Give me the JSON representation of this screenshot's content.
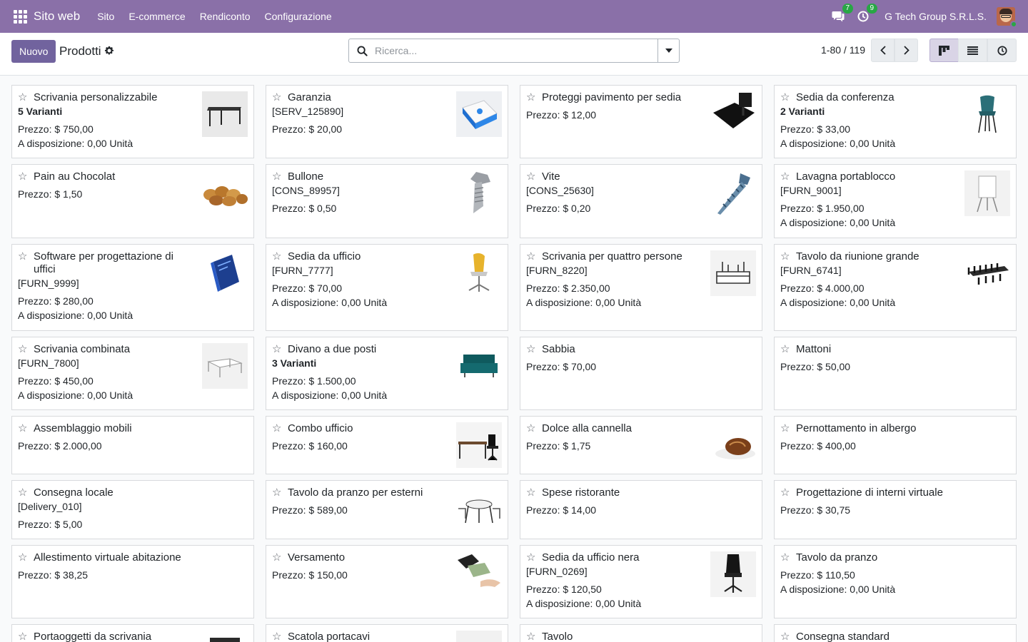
{
  "navbar": {
    "app_name": "Sito web",
    "menu": [
      "Sito",
      "E-commerce",
      "Rendiconto",
      "Configurazione"
    ],
    "messages_count": "7",
    "activities_count": "9",
    "company": "G Tech Group S.R.L.S."
  },
  "control_panel": {
    "new_label": "Nuovo",
    "title": "Prodotti",
    "search_placeholder": "Ricerca...",
    "pager": "1-80 / 119"
  },
  "products": [
    {
      "name": "Scrivania personalizzabile",
      "variants": "5 Varianti",
      "price": "Prezzo: $ 750,00",
      "stock": "A disposizione: 0,00 Unità",
      "image": "desk"
    },
    {
      "name": "Garanzia",
      "ref": "[SERV_125890]",
      "price": "Prezzo: $ 20,00",
      "image": "box"
    },
    {
      "name": "Proteggi pavimento per sedia",
      "price": "Prezzo: $ 12,00",
      "image": "mat"
    },
    {
      "name": "Sedia da conferenza",
      "variants": "2 Varianti",
      "price": "Prezzo: $ 33,00",
      "stock": "A disposizione: 0,00 Unità",
      "image": "chair-teal"
    },
    {
      "name": "Pain au Chocolat",
      "price": "Prezzo: $ 1,50",
      "image": "pastries"
    },
    {
      "name": "Bullone",
      "ref": "[CONS_89957]",
      "price": "Prezzo: $ 0,50",
      "image": "bolt"
    },
    {
      "name": "Vite",
      "ref": "[CONS_25630]",
      "price": "Prezzo: $ 0,20",
      "image": "screw"
    },
    {
      "name": "Lavagna portablocco",
      "ref": "[FURN_9001]",
      "price": "Prezzo: $ 1.950,00",
      "stock": "A disposizione: 0,00 Unità",
      "image": "flipchart"
    },
    {
      "name": "Software per progettazione di uffici",
      "ref": "[FURN_9999]",
      "price": "Prezzo: $ 280,00",
      "stock": "A disposizione: 0,00 Unità",
      "image": "software"
    },
    {
      "name": "Sedia da ufficio",
      "ref": "[FURN_7777]",
      "price": "Prezzo: $ 70,00",
      "stock": "A disposizione: 0,00 Unità",
      "image": "chair-yellow"
    },
    {
      "name": "Scrivania per quattro persone",
      "ref": "[FURN_8220]",
      "price": "Prezzo: $ 2.350,00",
      "stock": "A disposizione: 0,00 Unità",
      "image": "desk4"
    },
    {
      "name": "Tavolo da riunione grande",
      "ref": "[FURN_6741]",
      "price": "Prezzo: $ 4.000,00",
      "stock": "A disposizione: 0,00 Unità",
      "image": "meeting-table"
    },
    {
      "name": "Scrivania combinata",
      "ref": "[FURN_7800]",
      "price": "Prezzo: $ 450,00",
      "stock": "A disposizione: 0,00 Unità",
      "image": "combo-desk"
    },
    {
      "name": "Divano a due posti",
      "variants": "3 Varianti",
      "price": "Prezzo: $ 1.500,00",
      "stock": "A disposizione: 0,00 Unità",
      "image": "sofa"
    },
    {
      "name": "Sabbia",
      "price": "Prezzo: $ 70,00"
    },
    {
      "name": "Mattoni",
      "price": "Prezzo: $ 50,00"
    },
    {
      "name": "Assemblaggio mobili",
      "price": "Prezzo: $ 2.000,00"
    },
    {
      "name": "Combo ufficio",
      "price": "Prezzo: $ 160,00",
      "image": "office-combo"
    },
    {
      "name": "Dolce alla cannella",
      "price": "Prezzo: $ 1,75",
      "image": "cinnamon"
    },
    {
      "name": "Pernottamento in albergo",
      "price": "Prezzo: $ 400,00"
    },
    {
      "name": "Consegna locale",
      "ref": "[Delivery_010]",
      "price": "Prezzo: $ 5,00"
    },
    {
      "name": "Tavolo da pranzo per esterni",
      "price": "Prezzo: $ 589,00",
      "image": "outdoor-table"
    },
    {
      "name": "Spese ristorante",
      "price": "Prezzo: $ 14,00"
    },
    {
      "name": "Progettazione di interni virtuale",
      "price": "Prezzo: $ 30,75"
    },
    {
      "name": "Allestimento virtuale abitazione",
      "price": "Prezzo: $ 38,25"
    },
    {
      "name": "Versamento",
      "price": "Prezzo: $ 150,00",
      "image": "money"
    },
    {
      "name": "Sedia da ufficio nera",
      "ref": "[FURN_0269]",
      "price": "Prezzo: $ 120,50",
      "stock": "A disposizione: 0,00 Unità",
      "image": "chair-black"
    },
    {
      "name": "Tavolo da pranzo",
      "price": "Prezzo: $ 110,50",
      "stock": "A disposizione: 0,00 Unità"
    },
    {
      "name": "Portaoggetti da scrivania",
      "image": "organizer"
    },
    {
      "name": "Scatola portacavi",
      "image": "cable-box"
    },
    {
      "name": "Tavolo",
      "image": "table"
    },
    {
      "name": "Consegna standard"
    }
  ]
}
